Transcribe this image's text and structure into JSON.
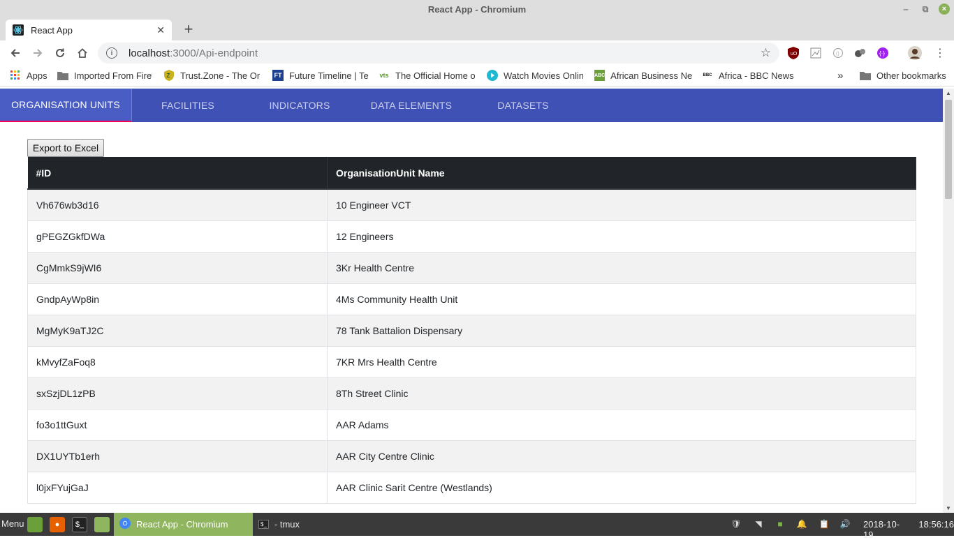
{
  "window": {
    "title": "React App - Chromium"
  },
  "browser": {
    "tab_title": "React App",
    "url_host": "localhost",
    "url_path": ":3000/Api-endpoint"
  },
  "bookmarks": {
    "apps": "Apps",
    "items": [
      "Imported From Firef",
      "Trust.Zone - The On",
      "Future Timeline | Te",
      "The Official Home o",
      "Watch Movies Onlin",
      "African Business Ne",
      "Africa - BBC News"
    ],
    "overflow": "»",
    "other": "Other bookmarks"
  },
  "app": {
    "tabs": [
      "ORGANISATION UNITS",
      "FACILITIES",
      "INDICATORS",
      "DATA ELEMENTS",
      "DATASETS"
    ],
    "export_label": "Export to Excel",
    "table": {
      "headers": [
        "#ID",
        "OrganisationUnit Name"
      ],
      "rows": [
        [
          "Vh676wb3d16",
          "10 Engineer VCT"
        ],
        [
          "gPEGZGkfDWa",
          "12 Engineers"
        ],
        [
          "CgMmkS9jWI6",
          "3Kr Health Centre"
        ],
        [
          "GndpAyWp8in",
          "4Ms Community Health Unit"
        ],
        [
          "MgMyK9aTJ2C",
          "78 Tank Battalion Dispensary"
        ],
        [
          "kMvyfZaFoq8",
          "7KR Mrs Health Centre"
        ],
        [
          "sxSzjDL1zPB",
          "8Th Street Clinic"
        ],
        [
          "fo3o1ttGuxt",
          "AAR Adams"
        ],
        [
          "DX1UYTb1erh",
          "AAR City Centre Clinic"
        ],
        [
          "l0jxFYujGaJ",
          "AAR Clinic Sarit Centre (Westlands)"
        ]
      ]
    }
  },
  "taskbar": {
    "menu": "Menu",
    "tasks": [
      "React App - Chromium",
      "- tmux"
    ],
    "date": "2018-10-19",
    "time": "18:56:16"
  },
  "colors": {
    "nav_bg": "#3f51b5",
    "nav_indicator": "#f50057",
    "table_header": "#212529",
    "taskbar_active": "#8fb55e"
  }
}
